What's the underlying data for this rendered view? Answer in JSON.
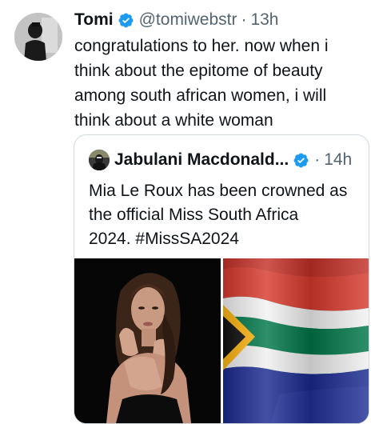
{
  "tweet": {
    "author_name": "Tomi",
    "handle": "@tomiwebstr",
    "separator": "·",
    "time": "13h",
    "text": "congratulations to her. now when i\nthink about the epitome of beauty\namong south african women, i will\nthink about a white woman",
    "avatar_icon": "profile-photo",
    "verified_icon": "verified-badge-icon",
    "verified_color": "#1d9bf0"
  },
  "quoted_tweet": {
    "author_name": "Jabulani Macdonald...",
    "separator": "·",
    "time": "14h",
    "text": "Mia Le Roux has been crowned as\nthe official Miss South Africa\n2024. #MissSA2024",
    "avatar_icon": "profile-photo",
    "verified_icon": "verified-badge-icon",
    "media": [
      {
        "kind": "photo",
        "icon": "woman-portrait-photo"
      },
      {
        "kind": "photo",
        "icon": "south-africa-flag-photo"
      }
    ]
  },
  "colors": {
    "text_primary": "#0f1419",
    "text_muted": "#536471",
    "border": "#cfd9de",
    "flag_red": "#e03c31",
    "flag_blue": "#001489",
    "flag_green": "#007749",
    "flag_gold": "#ffb612",
    "flag_black": "#000000",
    "flag_white": "#ffffff"
  }
}
